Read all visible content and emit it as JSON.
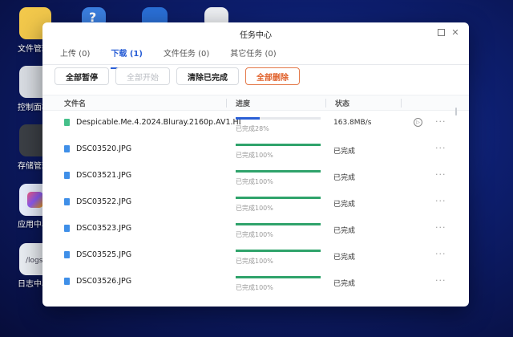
{
  "desktop": {
    "items": [
      {
        "label": "文件管理",
        "icon": "folder-icon",
        "color": "#f2c84b"
      },
      {
        "label": "控制面板",
        "icon": "control-panel-icon",
        "color": "#d9dde3"
      },
      {
        "label": "存储管理",
        "icon": "storage-icon",
        "color": "#3b3f45"
      },
      {
        "label": "应用中心",
        "icon": "app-center-icon",
        "color": "#e8eefc"
      },
      {
        "label": "日志中心",
        "icon": "log-icon",
        "color": "#e9edf2",
        "text": "/logs"
      }
    ],
    "top_icons": [
      {
        "icon": "help-icon",
        "glyph": "?"
      },
      {
        "icon": "bird-icon",
        "glyph": ""
      },
      {
        "icon": "note-icon",
        "glyph": ""
      }
    ]
  },
  "window": {
    "title": "任务中心",
    "tabs": [
      "上传 (0)",
      "下载 (1)",
      "文件任务 (0)",
      "其它任务 (0)"
    ],
    "active_tab": 1,
    "toolbar": {
      "pause_all": "全部暂停",
      "start_all": "全部开始",
      "clear_done": "清除已完成",
      "delete_all": "全部删除"
    },
    "columns": {
      "name": "文件名",
      "progress": "进度",
      "status": "状态"
    },
    "rows": [
      {
        "name": "Despicable.Me.4.2024.Bluray.2160p.AV1.HDR1 ...",
        "progress_text": "已完成28%",
        "progress": 0.28,
        "status": "163.8MB/s",
        "running": true
      },
      {
        "name": "DSC03520.JPG",
        "progress_text": "已完成100%",
        "progress": 1.0,
        "status": "已完成"
      },
      {
        "name": "DSC03521.JPG",
        "progress_text": "已完成100%",
        "progress": 1.0,
        "status": "已完成"
      },
      {
        "name": "DSC03522.JPG",
        "progress_text": "已完成100%",
        "progress": 1.0,
        "status": "已完成"
      },
      {
        "name": "DSC03523.JPG",
        "progress_text": "已完成100%",
        "progress": 1.0,
        "status": "已完成"
      },
      {
        "name": "DSC03525.JPG",
        "progress_text": "已完成100%",
        "progress": 1.0,
        "status": "已完成"
      },
      {
        "name": "DSC03526.JPG",
        "progress_text": "已完成100%",
        "progress": 1.0,
        "status": "已完成"
      }
    ]
  },
  "colors": {
    "accent": "#2a5fd6",
    "done": "#2fa36b",
    "danger": "#e0602a"
  }
}
